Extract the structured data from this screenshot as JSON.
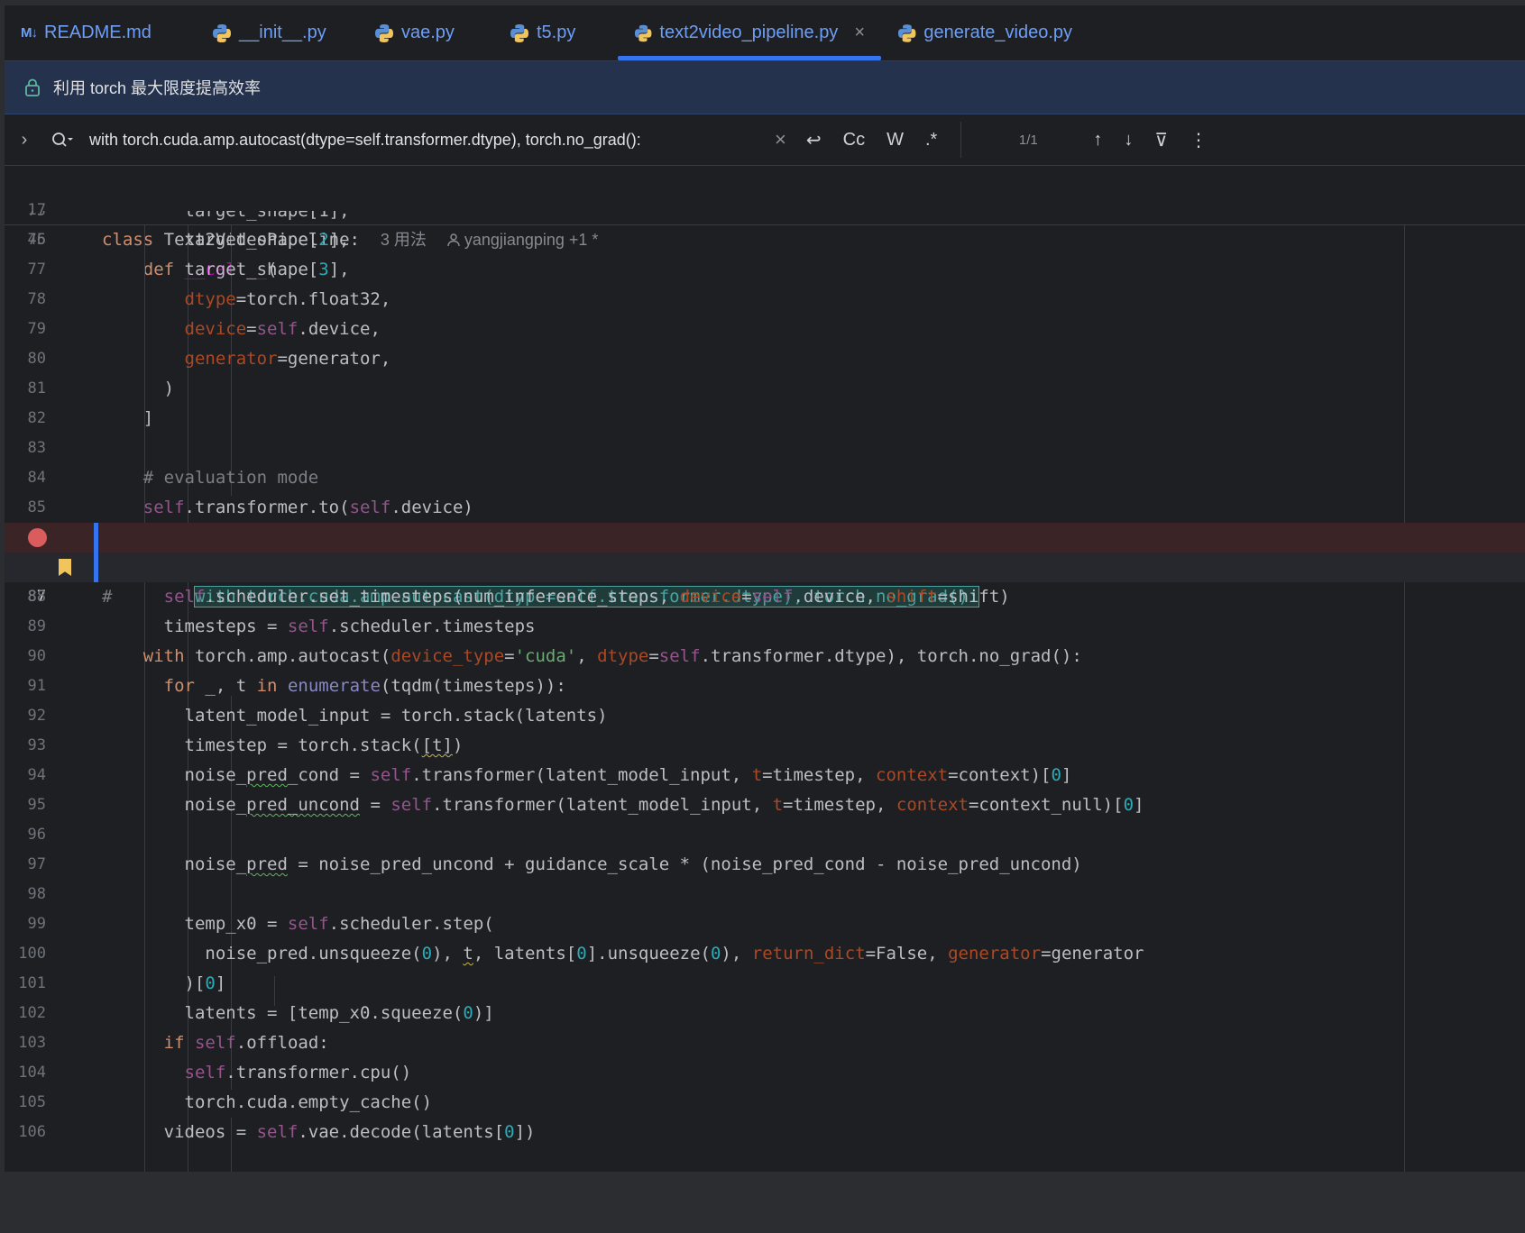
{
  "tabs": [
    {
      "label": "README.md",
      "icon": "markdown-icon",
      "badge": "M↓"
    },
    {
      "label": "__init__.py",
      "icon": "python-icon"
    },
    {
      "label": "vae.py",
      "icon": "python-icon"
    },
    {
      "label": "t5.py",
      "icon": "python-icon"
    },
    {
      "label": "text2video_pipeline.py",
      "icon": "python-icon",
      "active": true,
      "close": "×"
    },
    {
      "label": "generate_video.py",
      "icon": "python-icon"
    }
  ],
  "banner": {
    "text": "利用 torch 最大限度提高效率"
  },
  "search": {
    "chevron": "›",
    "query": "with torch.cuda.amp.autocast(dtype=self.transformer.dtype), torch.no_grad():",
    "clear": "×",
    "options": {
      "newline": "↩",
      "match_case": "Cc",
      "words": "W",
      "regex": ".*"
    },
    "count": "1/1",
    "prev": "↑",
    "next": "↓",
    "filter": "⊽",
    "more": "⋮"
  },
  "sticky": [
    {
      "ln": "17",
      "class_kw": "class",
      "class_name": "Text2VideoPipeline:",
      "usages": "3 用法",
      "author": "yangjiangping +1 *"
    },
    {
      "ln": "45",
      "def_kw": "def",
      "func": "__call__",
      "paren": "("
    }
  ],
  "line_numbers": [
    "75",
    "76",
    "77",
    "78",
    "79",
    "80",
    "81",
    "82",
    "83",
    "84",
    "85",
    "86",
    "87",
    "88",
    "89",
    "90",
    "91",
    "92",
    "93",
    "94",
    "95",
    "96",
    "97",
    "98",
    "99",
    "100",
    "101",
    "102",
    "103",
    "104",
    "105",
    "106"
  ],
  "code": {
    "l75": "target_shape[1],",
    "l76a": "target_shape[",
    "l76n": "2",
    "l76b": "],",
    "l77a": "target_shape[",
    "l77n": "3",
    "l77b": "],",
    "l78p": "dtype",
    "l78b": "=torch.float32,",
    "l79p": "device",
    "l79s": "self",
    "l79b": ".device,",
    "l80p": "generator",
    "l80b": "=generator,",
    "l81": ")",
    "l82": "]",
    "l84": "# evaluation mode",
    "l85s1": "self",
    "l85a": ".transformer.to(",
    "l85s2": "self",
    "l85b": ".device)",
    "l86hash": "#",
    "l86match": "with torch.cuda.amp.autocast(dtype=self.transformer.dtype), torch.no_grad():",
    "l87kw": "with",
    "l87a": " torch.amp.autocast(",
    "l87p1": "device_type",
    "l87eq": "=",
    "l87str": "'cuda'",
    "l87c": ", ",
    "l87p2": "dtype",
    "l87eq2": "=",
    "l87s": "self",
    "l87b": ".transformer.dtype), torch.no_grad():",
    "l88s": "self",
    "l88a": ".scheduler.set_timesteps(num_inference_steps, ",
    "l88p1": "device",
    "l88eq": "=",
    "l88s2": "self",
    "l88b": ".device, ",
    "l88p2": "shift",
    "l88c": "=shift)",
    "l89a": "timesteps = ",
    "l89s": "self",
    "l89b": ".scheduler.timesteps",
    "l91kw": "for",
    "l91a": " _, t ",
    "l91in": "in",
    "l91sp": " ",
    "l91fn": "enumerate",
    "l91b": "(tqdm(timesteps)):",
    "l92": "latent_model_input = torch.stack(latents)",
    "l93a": "timestep = torch.stack(",
    "l93sq": "[t]",
    "l93b": ")",
    "l94a": "noise_",
    "l94sq": "pred",
    "l94b": "_cond = ",
    "l94s": "self",
    "l94c": ".transformer(latent_model_input, ",
    "l94p1": "t",
    "l94d": "=timestep, ",
    "l94p2": "context",
    "l94e": "=context)[",
    "l94n": "0",
    "l94f": "]",
    "l95a": "noise_",
    "l95sq": "pred_uncond",
    "l95b": " = ",
    "l95s": "self",
    "l95c": ".transformer(latent_model_input, ",
    "l95p1": "t",
    "l95d": "=timestep, ",
    "l95p2": "context",
    "l95e": "=context_null)[",
    "l95n": "0",
    "l95f": "]",
    "l97a": "noise_",
    "l97sq": "pred",
    "l97b": " = noise_pred_uncond + guidance_scale * (noise_pred_cond - noise_pred_uncond)",
    "l99a": "temp_x0 = ",
    "l99s": "self",
    "l99b": ".scheduler.step(",
    "l100a": "noise_pred.unsqueeze(",
    "l100n1": "0",
    "l100b": "), ",
    "l100t": "t",
    "l100c": ", latents[",
    "l100n2": "0",
    "l100d": "].unsqueeze(",
    "l100n3": "0",
    "l100e": "), ",
    "l100p1": "return_dict",
    "l100f": "=False, ",
    "l100p2": "generator",
    "l100g": "=generator",
    "l101a": ")[",
    "l101n": "0",
    "l101b": "]",
    "l102a": "latents = [temp_x0.squeeze(",
    "l102n": "0",
    "l102b": ")]",
    "l103kw": "if",
    "l103sp": " ",
    "l103s": "self",
    "l103b": ".offload:",
    "l104s": "self",
    "l104b": ".transformer.cpu()",
    "l105": "torch.cuda.empty_cache()",
    "l106a": "videos = ",
    "l106s": "self",
    "l106b": ".vae.decode(latents[",
    "l106n": "0",
    "l106c": "])"
  }
}
